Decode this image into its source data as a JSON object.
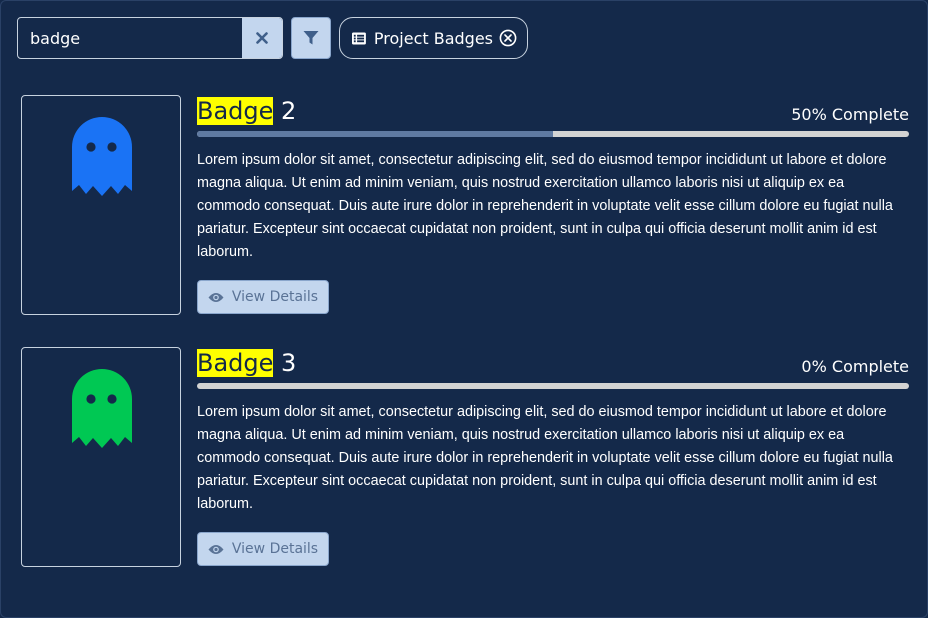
{
  "search": {
    "value": "badge",
    "clear_icon": "times-icon"
  },
  "filter": {
    "icon": "filter-icon"
  },
  "chip": {
    "label": "Project Badges",
    "icon": "list-icon",
    "remove_icon": "circle-x-icon"
  },
  "badges": [
    {
      "title_highlight": "Badge",
      "title_rest": " 2",
      "progress_text": "50% Complete",
      "progress": 0.5,
      "ghost_color": "#1a73f5",
      "description": "Lorem ipsum dolor sit amet, consectetur adipiscing elit, sed do eiusmod tempor incididunt ut labore et dolore magna aliqua. Ut enim ad minim veniam, quis nostrud exercitation ullamco laboris nisi ut aliquip ex ea commodo consequat. Duis aute irure dolor in reprehenderit in voluptate velit esse cillum dolore eu fugiat nulla pariatur. Excepteur sint occaecat cupidatat non proident, sunt in culpa qui officia deserunt mollit anim id est laborum.",
      "button_label": "View Details",
      "button_icon": "eye-icon"
    },
    {
      "title_highlight": "Badge",
      "title_rest": " 3",
      "progress_text": "0% Complete",
      "progress": 0,
      "ghost_color": "#00c853",
      "description": "Lorem ipsum dolor sit amet, consectetur adipiscing elit, sed do eiusmod tempor incididunt ut labore et dolore magna aliqua. Ut enim ad minim veniam, quis nostrud exercitation ullamco laboris nisi ut aliquip ex ea commodo consequat. Duis aute irure dolor in reprehenderit in voluptate velit esse cillum dolore eu fugiat nulla pariatur. Excepteur sint occaecat cupidatat non proident, sunt in culpa qui officia deserunt mollit anim id est laborum.",
      "button_label": "View Details",
      "button_icon": "eye-icon"
    }
  ],
  "colors": {
    "background": "#14294a",
    "highlight": "#ffff00",
    "button_bg": "#c3d6ee",
    "button_text": "#5a7396",
    "progress_fill": "#5f7aa2",
    "progress_track": "#d3d3d3"
  }
}
